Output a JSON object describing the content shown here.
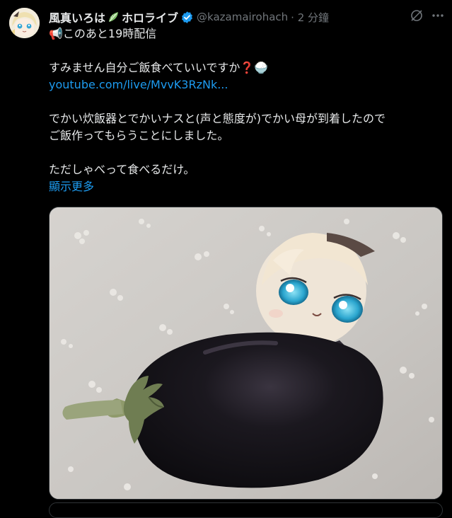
{
  "author": {
    "display_name": "風真いろは",
    "display_name_suffix": "ホロライブ",
    "handle": "@kazamairohach",
    "time": "· 2 分鐘"
  },
  "tweet": {
    "lines": [
      "📢このあと19時配信",
      "すみません自分ご飯食べていいですか❓🍚",
      "youtube.com/live/MvvK3RzNk...",
      "でかい炊飯器とでかいナスと(声と態度が)でかい母が到着したので",
      "ご飯作ってもらうことにしました。",
      "ただしゃべって食べるだけ。"
    ],
    "show_more": "顯示更多"
  },
  "icons": [
    "avatar",
    "leaf-icon",
    "verified-icon",
    "grok-icon",
    "more-icon"
  ],
  "colors": {
    "background": "#000000",
    "text": "#e7e9ea",
    "secondary": "#71767b",
    "link": "#1d9bf0",
    "verified": "#1d9bf0"
  }
}
